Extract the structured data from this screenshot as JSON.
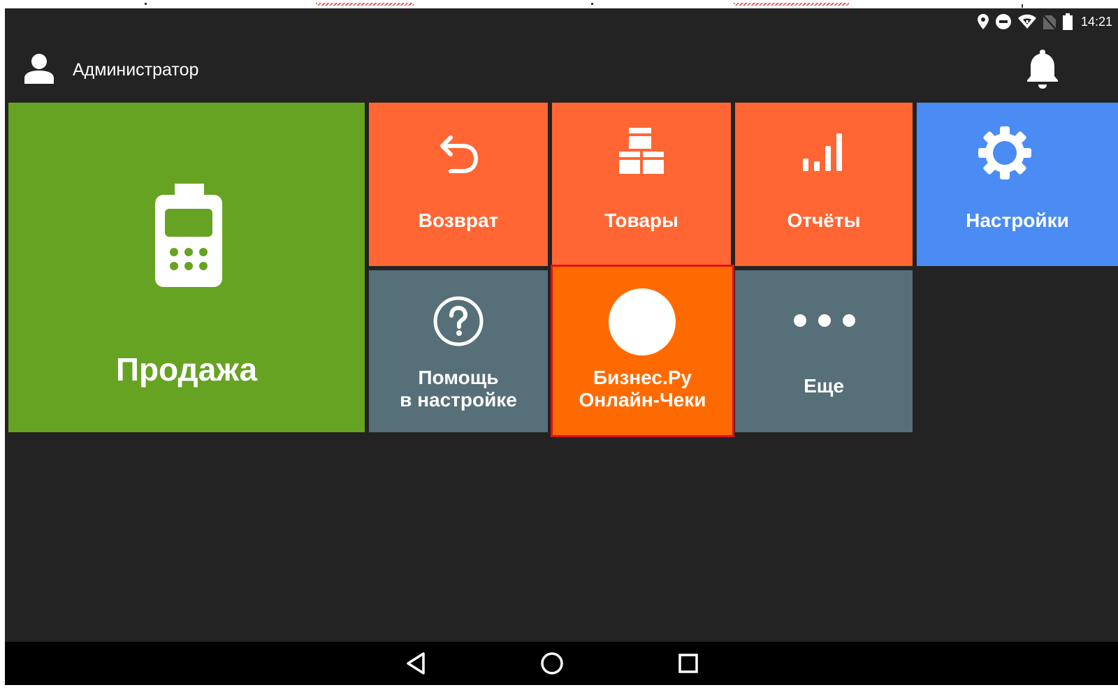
{
  "status_bar": {
    "time": "14:21",
    "icons": [
      "location-icon",
      "do-not-disturb-icon",
      "wifi-icon",
      "no-sim-icon",
      "battery-icon"
    ]
  },
  "app_bar": {
    "user_name": "Администратор",
    "user_icon": "user-icon",
    "notification_icon": "bell-icon"
  },
  "tiles": {
    "sale": {
      "label": "Продажа",
      "icon": "cash-register-icon",
      "color": "#67a322"
    },
    "return": {
      "label": "Возврат",
      "icon": "undo-icon",
      "color": "#ff6633"
    },
    "goods": {
      "label": "Товары",
      "icon": "boxes-icon",
      "color": "#ff6633"
    },
    "reports": {
      "label": "Отчёты",
      "icon": "bar-chart-icon",
      "color": "#ff6633"
    },
    "settings": {
      "label": "Настройки",
      "icon": "gear-icon",
      "color": "#4a8cf4"
    },
    "help": {
      "line1": "Помощь",
      "line2": "в настройке",
      "icon": "help-icon",
      "color": "#566f78"
    },
    "business": {
      "line1": "Бизнес.Ру",
      "line2": "Онлайн-Чеки",
      "icon": "app-logo-circle-icon",
      "color": "#ff6a00",
      "highlight": "#e0101a"
    },
    "more": {
      "label": "Еще",
      "icon": "more-dots-icon",
      "color": "#566f78"
    }
  },
  "nav_bar": {
    "buttons": [
      "back-icon",
      "home-icon",
      "recents-icon"
    ]
  }
}
